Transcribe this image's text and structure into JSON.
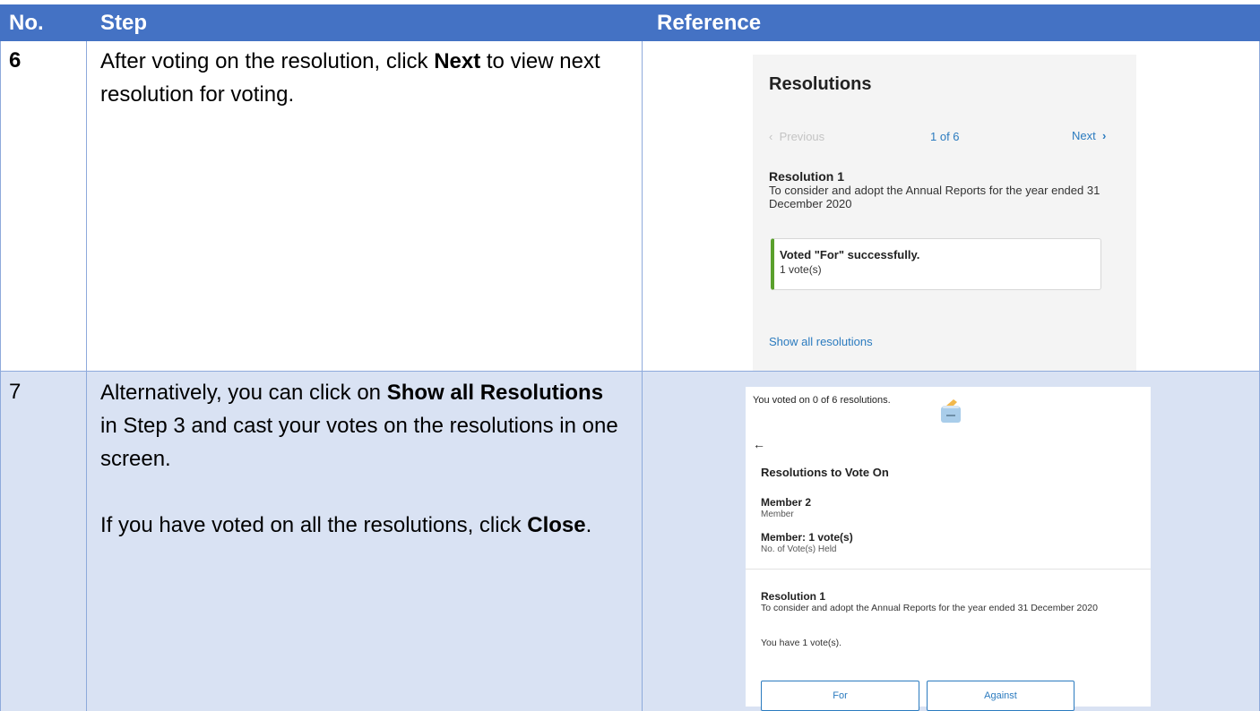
{
  "header": {
    "col_no": "No.",
    "col_step": "Step",
    "col_reference": "Reference"
  },
  "rows": [
    {
      "no": "6",
      "step_text": [
        [
          "After voting on the resolution, click ",
          "Next",
          " to view next resolution for voting."
        ]
      ]
    },
    {
      "no": "7",
      "step_text": [
        [
          "Alternatively, you can click on ",
          "Show all Resolutions",
          " in Step 3 and cast your votes on the resolutions in one screen."
        ],
        [
          "If you have voted on all the resolutions, click ",
          "Close",
          "."
        ]
      ]
    }
  ],
  "ref1": {
    "title": "Resolutions",
    "prev_label": "Previous",
    "page_indicator": "1 of 6",
    "next_label": "Next",
    "resolution_title": "Resolution 1",
    "resolution_desc": "To consider and adopt the Annual Reports for the year ended 31 December 2020",
    "status_title": "Voted \"For\" successfully.",
    "status_votes": "1 vote(s)",
    "show_all_link": "Show all resolutions"
  },
  "ref2": {
    "voted_summary": "You voted on 0 of 6 resolutions.",
    "section_title": "Resolutions to Vote On",
    "member_name": "Member 2",
    "member_role": "Member",
    "member_votes": "Member: 1 vote(s)",
    "votes_held_label": "No. of Vote(s) Held",
    "resolution_title": "Resolution 1",
    "resolution_desc": "To consider and adopt the Annual Reports for the year ended 31 December 2020",
    "you_have": "You have 1 vote(s).",
    "for_label": "For",
    "against_label": "Against"
  },
  "colors": {
    "header_bg": "#4472c4",
    "row_alt_bg": "#d9e2f3",
    "border": "#8eaadb",
    "link": "#2b7bbf",
    "success": "#5aa02c"
  }
}
